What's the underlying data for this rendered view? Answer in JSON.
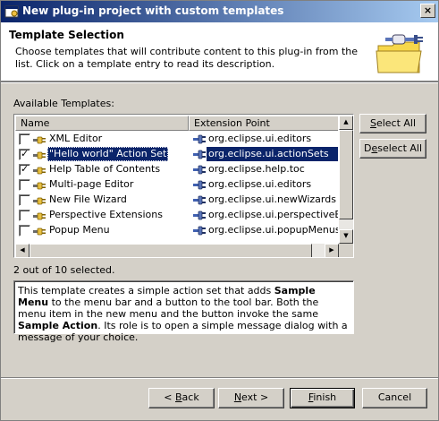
{
  "window": {
    "title": "New plug-in project with custom templates",
    "close_glyph": "×"
  },
  "header": {
    "section_title": "Template Selection",
    "description": "Choose templates that will contribute content to this plug-in from the list. Click on a template entry to read its description."
  },
  "templates": {
    "label": "Available Templates:",
    "columns": [
      "Name",
      "Extension Point"
    ],
    "rows": [
      {
        "name": "XML Editor",
        "ext": "org.eclipse.ui.editors",
        "checked": false,
        "selected": false
      },
      {
        "name": "\"Hello world\" Action Set",
        "ext": "org.eclipse.ui.actionSets",
        "checked": true,
        "selected": true
      },
      {
        "name": "Help Table of Contents",
        "ext": "org.eclipse.help.toc",
        "checked": true,
        "selected": false
      },
      {
        "name": "Multi-page Editor",
        "ext": "org.eclipse.ui.editors",
        "checked": false,
        "selected": false
      },
      {
        "name": "New File Wizard",
        "ext": "org.eclipse.ui.newWizards",
        "checked": false,
        "selected": false
      },
      {
        "name": "Perspective Extensions",
        "ext": "org.eclipse.ui.perspectiveExte",
        "checked": false,
        "selected": false
      },
      {
        "name": "Popup Menu",
        "ext": "org.eclipse.ui.popupMenus",
        "checked": false,
        "selected": false
      }
    ],
    "status": "2 out of 10 selected.",
    "tick_glyph": "✓"
  },
  "buttons": {
    "select_all": {
      "pre": "",
      "mnemonic": "S",
      "post": "elect All"
    },
    "deselect_all": {
      "pre": "D",
      "mnemonic": "e",
      "post": "select All"
    },
    "back": {
      "pre": "< ",
      "mnemonic": "B",
      "post": "ack"
    },
    "next": {
      "pre": "",
      "mnemonic": "N",
      "post": "ext >"
    },
    "finish": {
      "pre": "",
      "mnemonic": "F",
      "post": "inish"
    },
    "cancel": {
      "pre": "",
      "mnemonic": "",
      "post": "Cancel"
    }
  },
  "description": {
    "parts": [
      "This template creates a simple action set that adds ",
      "Sample Menu",
      " to the menu bar and a button to the tool bar. Both the menu item in the new menu and the button invoke the same ",
      "Sample Action",
      ". Its role is to open a simple message dialog with a message of your choice."
    ]
  },
  "colors": {
    "selection": "#0a246a",
    "face": "#d4d0c8",
    "title_gradient_end": "#a6caf0"
  },
  "icons": {
    "row_icon": "plug-icon",
    "ext_icon": "extension-point-icon",
    "wizard_banner": "plug-in-folder-icon"
  }
}
